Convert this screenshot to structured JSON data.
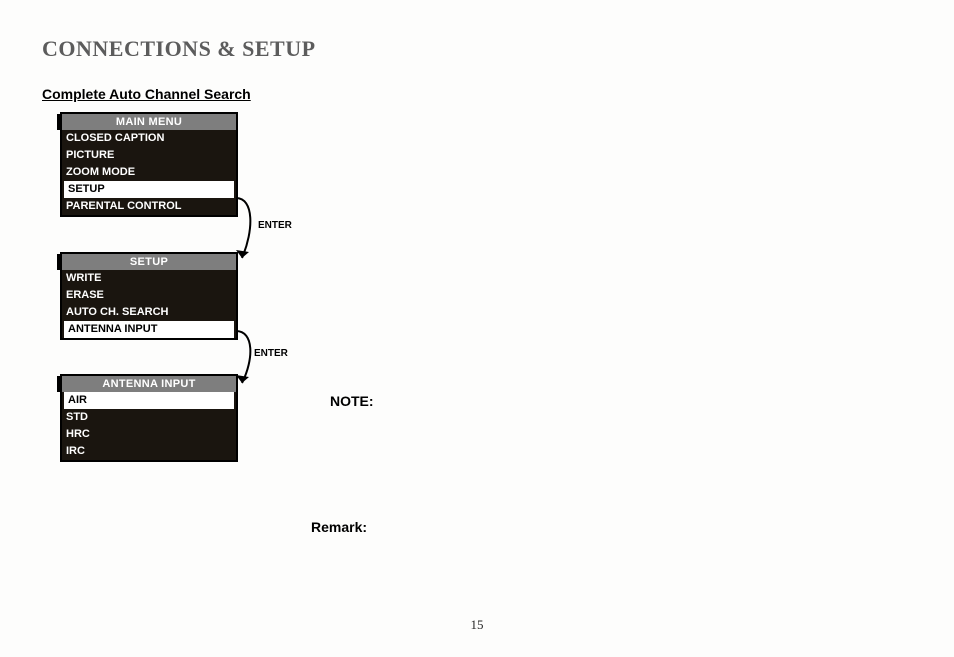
{
  "title": "CONNECTIONS & SETUP",
  "subheading": "Complete Auto Channel Search",
  "menus": {
    "main": {
      "header": "MAIN MENU",
      "items": [
        "CLOSED CAPTION",
        "PICTURE",
        "ZOOM MODE",
        "SETUP",
        "PARENTAL CONTROL"
      ],
      "highlightIndex": 3
    },
    "setup": {
      "header": "SETUP",
      "items": [
        "WRITE",
        "ERASE",
        "AUTO CH. SEARCH",
        "ANTENNA INPUT"
      ],
      "highlightIndex": 3
    },
    "antenna": {
      "header": "ANTENNA INPUT",
      "items": [
        "AIR",
        "STD",
        "HRC",
        "IRC"
      ],
      "highlightIndex": 0
    }
  },
  "labels": {
    "enter1": "ENTER",
    "enter2": "ENTER",
    "note": "NOTE:",
    "remark": "Remark:"
  },
  "pageNumber": "15"
}
